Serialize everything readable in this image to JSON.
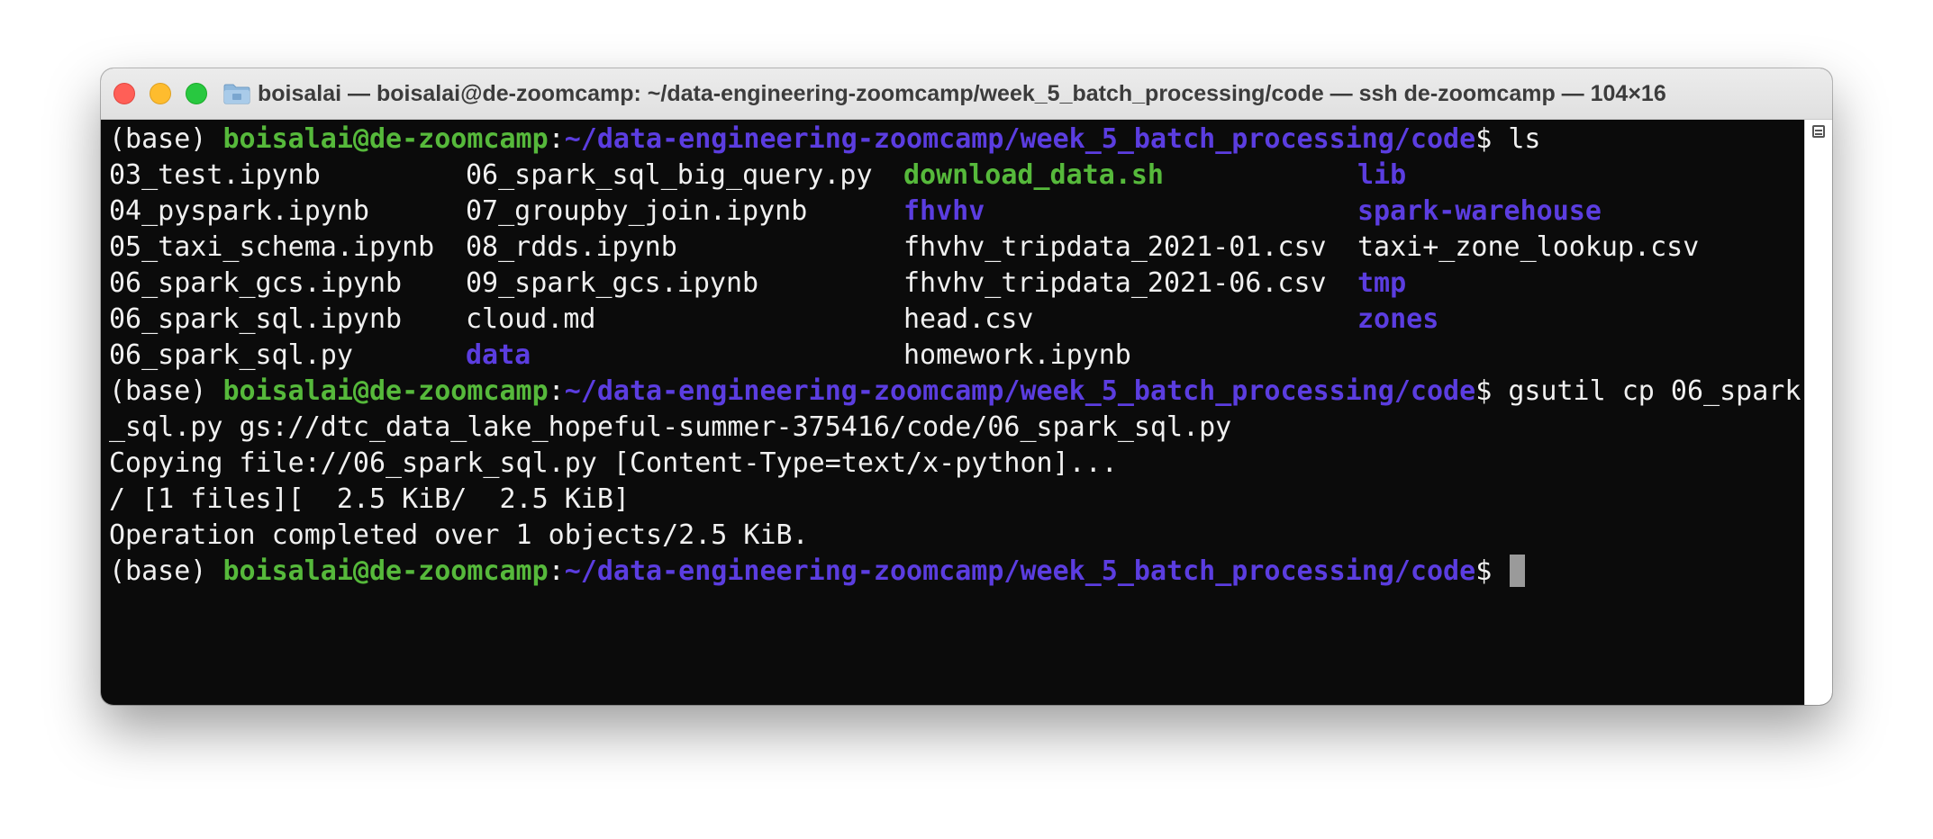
{
  "window": {
    "title": "boisalai — boisalai@de-zoomcamp: ~/data-engineering-zoomcamp/week_5_batch_processing/code — ssh de-zoomcamp — 104×16"
  },
  "prompt": {
    "env": "(base) ",
    "user_host": "boisalai@de-zoomcamp",
    "sep": ":",
    "path": "~/data-engineering-zoomcamp/week_5_batch_processing/code",
    "symbol": "$ "
  },
  "commands": {
    "ls": "ls",
    "gsutil_part1": "gsutil cp 06_spark",
    "gsutil_part2": "_sql.py gs://dtc_data_lake_hopeful-summer-375416/code/06_spark_sql.py"
  },
  "ls_output": {
    "rows": [
      [
        "03_test.ipynb",
        "06_spark_sql_big_query.py",
        "download_data.sh",
        "lib"
      ],
      [
        "04_pyspark.ipynb",
        "07_groupby_join.ipynb",
        "fhvhv",
        "spark-warehouse"
      ],
      [
        "05_taxi_schema.ipynb",
        "08_rdds.ipynb",
        "fhvhv_tripdata_2021-01.csv",
        "taxi+_zone_lookup.csv"
      ],
      [
        "06_spark_gcs.ipynb",
        "09_spark_gcs.ipynb",
        "fhvhv_tripdata_2021-06.csv",
        "tmp"
      ],
      [
        "06_spark_sql.ipynb",
        "cloud.md",
        "head.csv",
        "zones"
      ],
      [
        "06_spark_sql.py",
        "data",
        "homework.ipynb",
        ""
      ]
    ]
  },
  "output": {
    "copying": "Copying file://06_spark_sql.py [Content-Type=text/x-python]...",
    "progress": "/ [1 files][  2.5 KiB/  2.5 KiB]",
    "completed": "Operation completed over 1 objects/2.5 KiB."
  },
  "colors": {
    "user_host": "#56b93b",
    "path": "#5b3de0",
    "directory": "#5b3de0",
    "executable": "#56b93b",
    "background": "#0b0b0b",
    "foreground": "#f0f0f0"
  },
  "icons": {
    "close": "close-icon",
    "minimize": "minimize-icon",
    "maximize": "maximize-icon",
    "folder": "folder-icon",
    "scroll_marker": "mark-icon"
  }
}
